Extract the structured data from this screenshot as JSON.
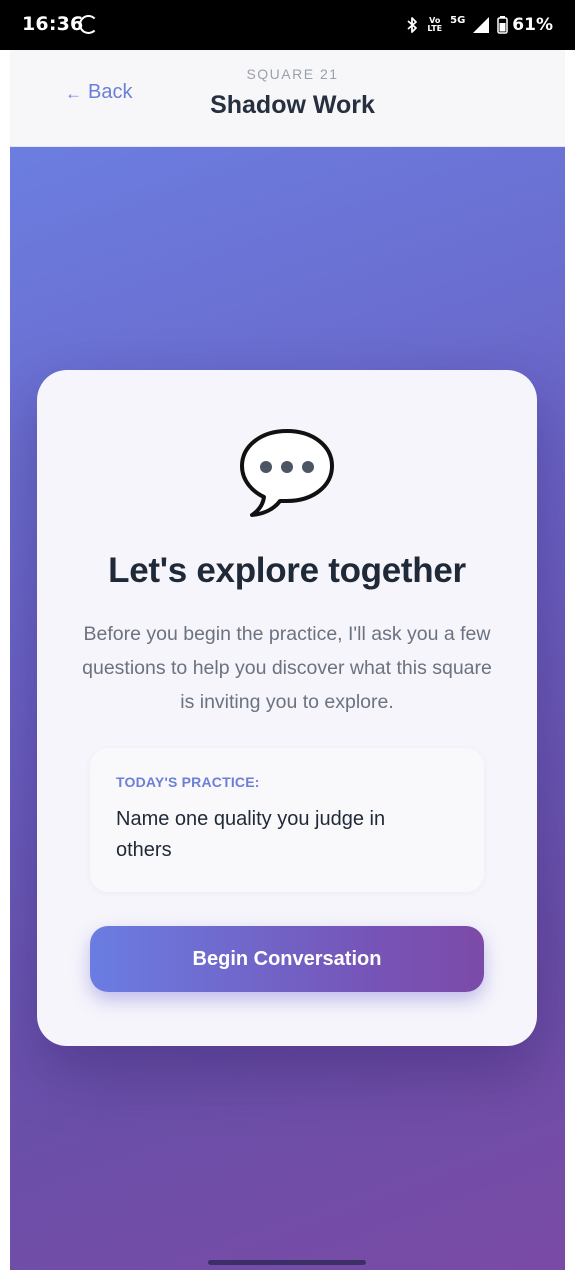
{
  "status_bar": {
    "time": "16:36",
    "volte_top": "Vo",
    "volte_bottom": "LTE",
    "network": "5G",
    "battery": "61%"
  },
  "header": {
    "back_label": "Back",
    "back_arrow": "←",
    "overline": "SQUARE 21",
    "title": "Shadow Work"
  },
  "card": {
    "icon": "speech-bubble-icon",
    "heading": "Let's explore together",
    "body": "Before you begin the practice, I'll ask you a few questions to help you discover what this square is inviting you to explore.",
    "practice_label": "TODAY'S PRACTICE:",
    "practice_text": "Name one quality you judge in others",
    "button_label": "Begin Conversation"
  },
  "colors": {
    "accent": "#6b7fd6",
    "gradient_start": "#6b7ee0",
    "gradient_end": "#7a4ba6",
    "heading": "#1f2937",
    "muted": "#6b7280"
  }
}
